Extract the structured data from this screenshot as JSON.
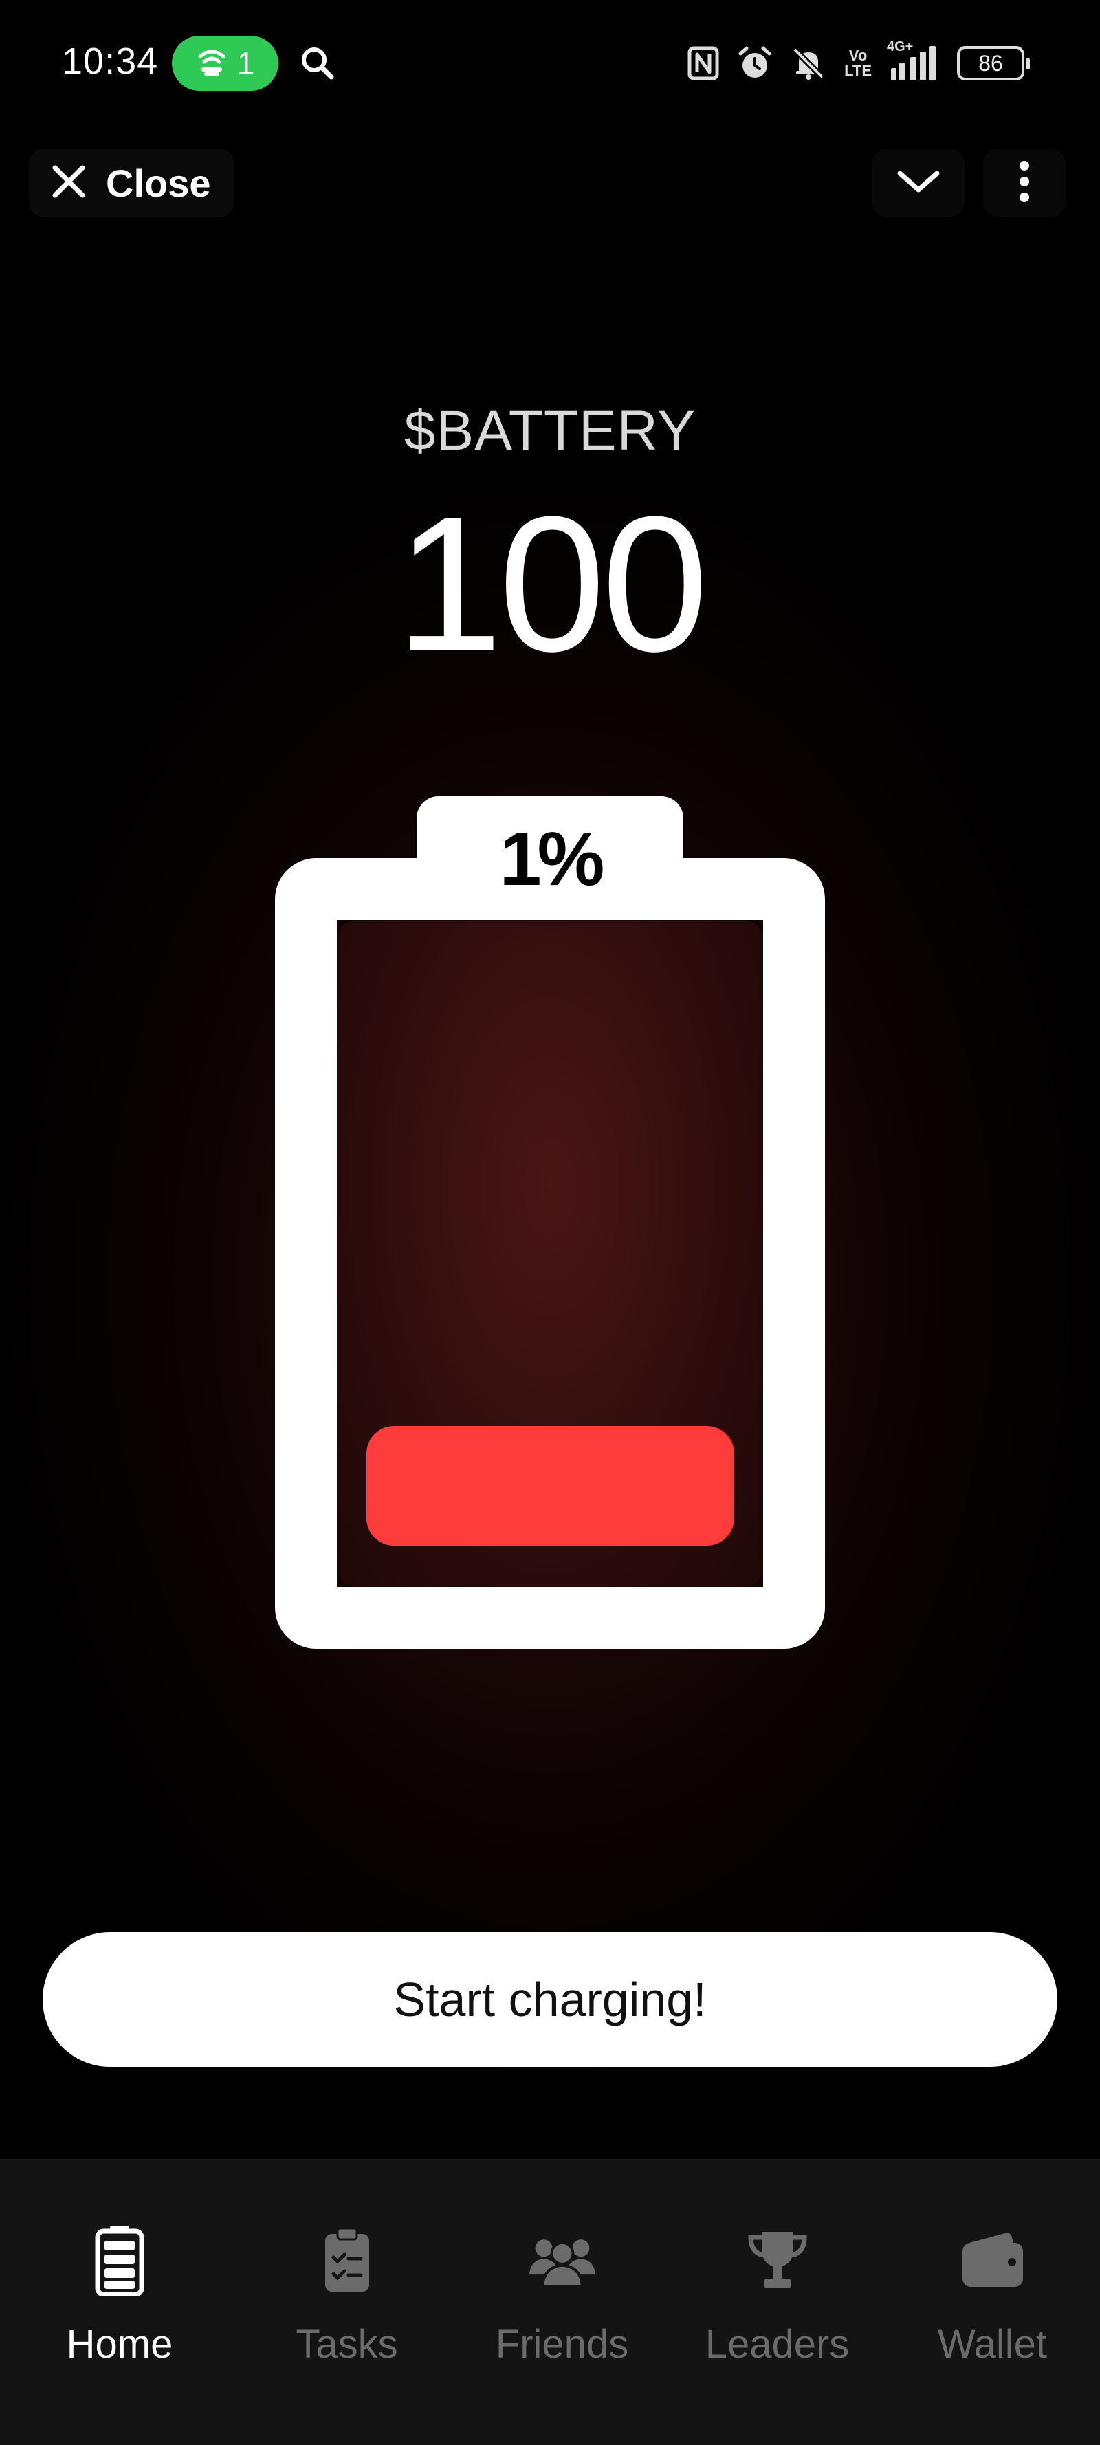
{
  "status_bar": {
    "time": "10:34",
    "hotspot_count": "1",
    "volte_line1": "Vo",
    "volte_line2": "LTE",
    "network": "4G+",
    "battery_level": "86",
    "icons": [
      "hotspot-icon",
      "search-icon",
      "nfc-icon",
      "alarm-icon",
      "mute-icon",
      "volte-icon",
      "signal-icon",
      "battery-icon"
    ]
  },
  "app_bar": {
    "close_label": "Close",
    "icons": [
      "close-icon",
      "chevron-down-icon",
      "more-vertical-icon"
    ]
  },
  "token": {
    "name": "$BATTERY",
    "balance": "100"
  },
  "battery_widget": {
    "percent_label": "1%",
    "fill_color": "#ff3c3c"
  },
  "cta": {
    "label": "Start charging!"
  },
  "bottom_nav": {
    "items": [
      {
        "label": "Home",
        "icon": "battery-icon",
        "active": true
      },
      {
        "label": "Tasks",
        "icon": "clipboard-check-icon",
        "active": false
      },
      {
        "label": "Friends",
        "icon": "users-icon",
        "active": false
      },
      {
        "label": "Leaders",
        "icon": "trophy-icon",
        "active": false
      },
      {
        "label": "Wallet",
        "icon": "wallet-icon",
        "active": false
      }
    ]
  },
  "colors": {
    "accent_red": "#ff3c3c",
    "hotspot_green": "#2fc956",
    "nav_inactive": "#6b6b6b",
    "background": "#000000"
  }
}
